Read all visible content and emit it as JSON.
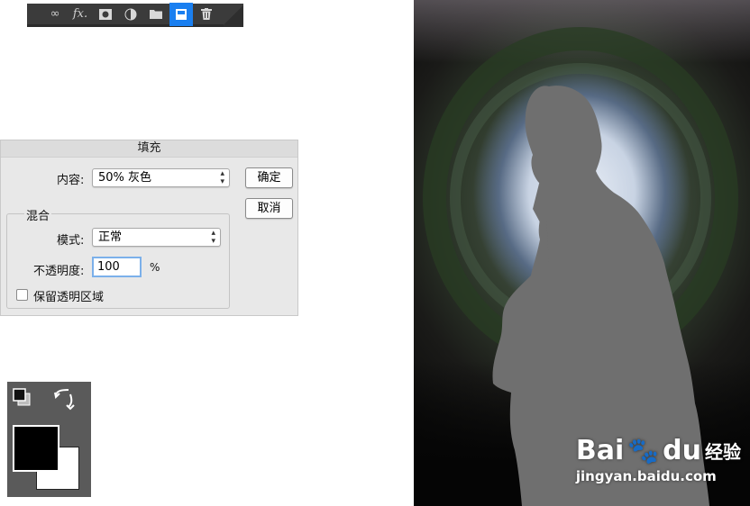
{
  "layers_toolbar": {
    "buttons": [
      {
        "name": "link-layers",
        "glyph": "∞"
      },
      {
        "name": "add-layer-style",
        "glyph": "fx."
      },
      {
        "name": "add-layer-mask",
        "glyph": ""
      },
      {
        "name": "new-adjustment-layer",
        "glyph": ""
      },
      {
        "name": "new-group",
        "glyph": ""
      },
      {
        "name": "new-layer",
        "glyph": ""
      },
      {
        "name": "delete-layer",
        "glyph": ""
      }
    ],
    "active": "new-layer",
    "active_color": "#1a7ff0"
  },
  "fill_dialog": {
    "title": "填充",
    "contents_label": "内容:",
    "contents_value": "50% 灰色",
    "ok_label": "确定",
    "cancel_label": "取消",
    "blending_group": "混合",
    "mode_label": "模式:",
    "mode_value": "正常",
    "opacity_label": "不透明度:",
    "opacity_value": "100",
    "opacity_unit": "%",
    "preserve_label": "保留透明区域",
    "preserve_checked": false
  },
  "color_swatches": {
    "foreground": "#000000",
    "background": "#ffffff"
  },
  "watermark": {
    "brand_latin": "Bai",
    "brand_after": "du",
    "brand_cn": "经验",
    "url": "jingyan.baidu.com"
  }
}
